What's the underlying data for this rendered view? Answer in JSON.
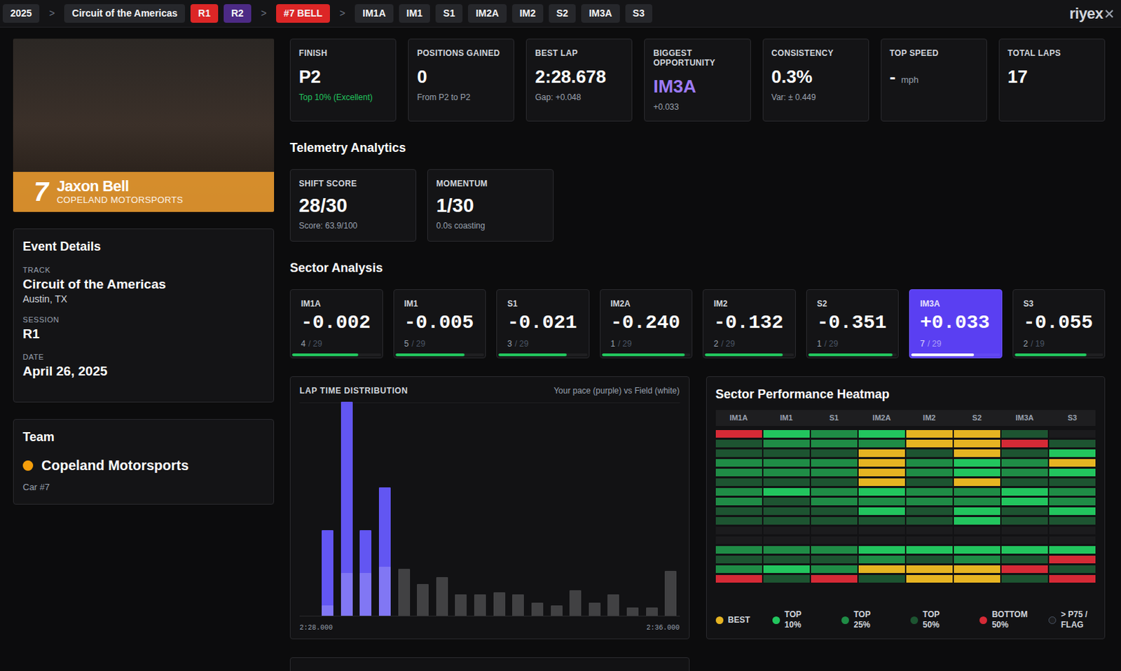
{
  "topbar": {
    "items": [
      {
        "label": "2025",
        "kind": "pill",
        "color": "#26272b"
      },
      {
        "label": ">",
        "kind": "separator",
        "color": "#6b7280"
      },
      {
        "label": "Circuit of the Americas",
        "kind": "pill",
        "color": "#26272b"
      },
      {
        "label": "R1",
        "kind": "pill",
        "color": "#dc2626"
      },
      {
        "label": "R2",
        "kind": "pill",
        "color": "#4c2a85"
      },
      {
        "label": ">",
        "kind": "separator",
        "color": "#6b7280"
      },
      {
        "label": "#7 BELL",
        "kind": "pill",
        "color": "#dc2626"
      },
      {
        "label": ">",
        "kind": "separator",
        "color": "#6b7280"
      },
      {
        "label": "IM1A",
        "kind": "pill",
        "color": "#26272b"
      },
      {
        "label": "IM1",
        "kind": "pill",
        "color": "#26272b"
      },
      {
        "label": "S1",
        "kind": "pill",
        "color": "#26272b"
      },
      {
        "label": "IM2A",
        "kind": "pill",
        "color": "#26272b"
      },
      {
        "label": "IM2",
        "kind": "pill",
        "color": "#26272b"
      },
      {
        "label": "S2",
        "kind": "pill",
        "color": "#26272b"
      },
      {
        "label": "IM3A",
        "kind": "pill",
        "color": "#26272b"
      },
      {
        "label": "S3",
        "kind": "pill",
        "color": "#26272b"
      }
    ],
    "logo": "riyex"
  },
  "driver": {
    "number": "7",
    "name": "Jaxon Bell",
    "team": "COPELAND MOTORSPORTS"
  },
  "event": {
    "title": "Event Details",
    "fields": [
      {
        "label": "TRACK",
        "value": "Circuit of the Americas",
        "detail": "Austin, TX"
      },
      {
        "label": "SESSION",
        "value": "R1",
        "detail": ""
      },
      {
        "label": "DATE",
        "value": "April 26, 2025",
        "detail": ""
      }
    ]
  },
  "team": {
    "title": "Team",
    "name": "Copeland Motorsports",
    "color": "#f59e0b",
    "car": "Car #7"
  },
  "stats": [
    {
      "label": "FINISH",
      "value": "P2",
      "unit": "",
      "sub": "Top 10% (Excellent)",
      "color": "#ffffff",
      "sub_color": "#22c55e"
    },
    {
      "label": "POSITIONS GAINED",
      "value": "0",
      "unit": "",
      "sub": "From P2 to P2",
      "color": "#ffffff",
      "sub_color": "#9ca3af"
    },
    {
      "label": "BEST LAP",
      "value": "2:28.678",
      "unit": "",
      "sub": "Gap: +0.048",
      "color": "#ffffff",
      "sub_color": "#9ca3af"
    },
    {
      "label": "BIGGEST OPPORTUNITY",
      "value": "IM3A",
      "unit": "",
      "sub": "+0.033",
      "color": "#9d7bf7",
      "sub_color": "#9ca3af"
    },
    {
      "label": "CONSISTENCY",
      "value": "0.3%",
      "unit": "",
      "sub": "Var: ± 0.449",
      "color": "#ffffff",
      "sub_color": "#9ca3af"
    },
    {
      "label": "TOP SPEED",
      "value": "-",
      "unit": "mph",
      "sub": "",
      "color": "#ffffff",
      "sub_color": "#9ca3af"
    },
    {
      "label": "TOTAL LAPS",
      "value": "17",
      "unit": "",
      "sub": "",
      "color": "#ffffff",
      "sub_color": "#9ca3af"
    }
  ],
  "telemetry": {
    "title": "Telemetry Analytics",
    "cards": [
      {
        "label": "SHIFT SCORE",
        "value": "28/30",
        "sub": "Score: 63.9/100"
      },
      {
        "label": "MOMENTUM",
        "value": "1/30",
        "sub": "0.0s coasting"
      }
    ]
  },
  "sectors": {
    "title": "Sector Analysis",
    "items": [
      {
        "name": "IM1A",
        "delta": "-0.002",
        "rank": "4",
        "of": "/ 29",
        "level": 0.75,
        "selected": false
      },
      {
        "name": "IM1",
        "delta": "-0.005",
        "rank": "5",
        "of": "/ 29",
        "level": 0.78,
        "selected": false
      },
      {
        "name": "S1",
        "delta": "-0.021",
        "rank": "3",
        "of": "/ 29",
        "level": 0.77,
        "selected": false
      },
      {
        "name": "IM2A",
        "delta": "-0.240",
        "rank": "1",
        "of": "/ 29",
        "level": 0.94,
        "selected": false
      },
      {
        "name": "IM2",
        "delta": "-0.132",
        "rank": "2",
        "of": "/ 29",
        "level": 0.88,
        "selected": false
      },
      {
        "name": "S2",
        "delta": "-0.351",
        "rank": "1",
        "of": "/ 29",
        "level": 0.95,
        "selected": false
      },
      {
        "name": "IM3A",
        "delta": "+0.033",
        "rank": "7",
        "of": "/ 29",
        "level": 0.71,
        "selected": true
      },
      {
        "name": "S3",
        "delta": "-0.055",
        "rank": "2",
        "of": "/ 19",
        "level": 0.81,
        "selected": false
      }
    ]
  },
  "chart": {
    "title": "LAP TIME DISTRIBUTION",
    "legend": "Your pace (purple) vs Field (white)",
    "x_min": "2:28.000",
    "x_max": "2:36.000",
    "driver": [
      2,
      5,
      2,
      3,
      0,
      0,
      0,
      0,
      0,
      0,
      0,
      0,
      0,
      0,
      0,
      0,
      0,
      0,
      0
    ],
    "field": [
      0.25,
      1.0,
      1.0,
      1.15,
      1.1,
      0.75,
      0.9,
      0.5,
      0.5,
      0.55,
      0.5,
      0.3,
      0.25,
      0.6,
      0.3,
      0.5,
      0.2,
      0.2,
      1.05
    ]
  },
  "heatmap": {
    "title": "Sector Performance Heatmap",
    "columns": [
      "IM1A",
      "IM1",
      "S1",
      "IM2A",
      "IM2",
      "S2",
      "IM3A",
      "S3"
    ],
    "rows": [
      [
        "bottom50",
        "top10",
        "top25",
        "top10",
        "best",
        "best",
        "top50",
        "flag"
      ],
      [
        "top50",
        "top25",
        "top25",
        "top25",
        "best",
        "best",
        "bottom50",
        "top50"
      ],
      [
        "top50",
        "top50",
        "top50",
        "best",
        "top50",
        "best",
        "top50",
        "top10"
      ],
      [
        "top25",
        "top25",
        "top25",
        "best",
        "top25",
        "top10",
        "top25",
        "best"
      ],
      [
        "top25",
        "top25",
        "top25",
        "best",
        "top25",
        "top10",
        "top25",
        "top10"
      ],
      [
        "top50",
        "top50",
        "top50",
        "best",
        "top50",
        "best",
        "top50",
        "top50"
      ],
      [
        "top25",
        "top10",
        "top25",
        "top10",
        "top25",
        "top25",
        "top10",
        "top25"
      ],
      [
        "top25",
        "top50",
        "top25",
        "top25",
        "top25",
        "top25",
        "top10",
        "top25"
      ],
      [
        "top50",
        "top50",
        "top50",
        "top10",
        "top50",
        "top10",
        "top50",
        "top10"
      ],
      [
        "top50",
        "top50",
        "top50",
        "top50",
        "top50",
        "top10",
        "top50",
        "top50"
      ],
      [
        "flag",
        "flag",
        "flag",
        "flag",
        "flag",
        "flag",
        "flag",
        "flag"
      ],
      [
        "flag",
        "flag",
        "flag",
        "flag",
        "flag",
        "flag",
        "flag",
        "flag"
      ],
      [
        "top25",
        "top25",
        "top25",
        "top10",
        "top10",
        "top10",
        "top10",
        "top10"
      ],
      [
        "top50",
        "top50",
        "top50",
        "top25",
        "top50",
        "top25",
        "top50",
        "bottom50"
      ],
      [
        "top25",
        "top10",
        "top25",
        "best",
        "best",
        "best",
        "bottom50",
        "top50"
      ],
      [
        "bottom50",
        "top50",
        "bottom50",
        "top50",
        "best",
        "best",
        "top50",
        "bottom50"
      ]
    ],
    "legend": [
      {
        "key": "best",
        "label": "BEST",
        "color": "#e6b422",
        "kind": "filled"
      },
      {
        "key": "top10",
        "label": "TOP 10%",
        "color": "#22c55e",
        "kind": "filled"
      },
      {
        "key": "top25",
        "label": "TOP 25%",
        "color": "#1f8c46",
        "kind": "filled"
      },
      {
        "key": "top50",
        "label": "TOP 50%",
        "color": "#1d5431",
        "kind": "filled"
      },
      {
        "key": "bottom50",
        "label": "BOTTOM 50%",
        "color": "#d52a36",
        "kind": "filled"
      },
      {
        "key": "flag",
        "label": "> P75 / FLAG",
        "color": "#1b1b1d",
        "kind": "hollow"
      }
    ]
  }
}
